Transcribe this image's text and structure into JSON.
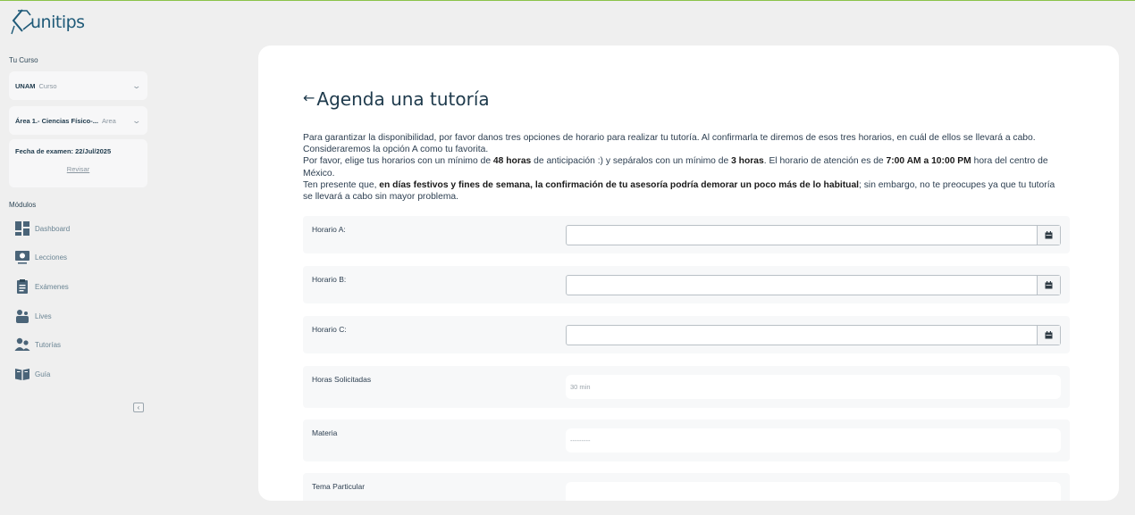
{
  "app": {
    "logo_text": "unitips",
    "logo_icon": "graduation-cap-icon",
    "accent": "#1f5a78",
    "top_border": "#8bc34a"
  },
  "sidebar": {
    "course_label": "Tu Curso",
    "course_select": {
      "strong": "UNAM",
      "muted": "Curso"
    },
    "area_select": {
      "strong": "Área 1.- Ciencias Físico-...",
      "muted": "Area"
    },
    "exam": {
      "text": "Fecha de examen: 22/Jul/2025",
      "link": "Revisar"
    },
    "modules_label": "Módulos",
    "items": [
      {
        "label": "Dashboard",
        "icon": "dashboard-icon"
      },
      {
        "label": "Lecciones",
        "icon": "lessons-icon"
      },
      {
        "label": "Exámenes",
        "icon": "exams-icon"
      },
      {
        "label": "Lives",
        "icon": "lives-icon"
      },
      {
        "label": "Tutorías",
        "icon": "tutoring-icon"
      },
      {
        "label": "Guía",
        "icon": "guide-icon"
      }
    ],
    "collapse_glyph": "‹"
  },
  "main": {
    "back_glyph": "←",
    "title": "Agenda una tutoría",
    "desc": {
      "p1": "Para garantizar la disponibilidad, por favor danos tres opciones de horario para realizar tu tutoría. Al confirmarla te diremos de esos tres horarios, en cuál de ellos se llevará a cabo. Consideraremos la opción A como tu favorita.",
      "p2a": "Por favor, elige tus horarios con un mínimo de ",
      "p2b": "48 horas",
      "p2c": " de anticipación :) y sepáralos con un mínimo de ",
      "p2d": "3 horas",
      "p2e": ". El horario de atención es de ",
      "p2f": "7:00 AM a 10:00 PM",
      "p2g": " hora del centro de México.",
      "p3a": "Ten presente que, ",
      "p3b": "en días festivos y fines de semana, la confirmación de tu asesoría podría demorar un poco más de lo habitual",
      "p3c": "; sin embargo, no te preocupes ya que tu tutoría se llevará a cabo sin mayor problema."
    },
    "fields": {
      "horario_a": {
        "label": "Horario A:",
        "value": ""
      },
      "horario_b": {
        "label": "Horario B:",
        "value": ""
      },
      "horario_c": {
        "label": "Horario C:",
        "value": ""
      },
      "horas": {
        "label": "Horas Solicitadas",
        "value": "30 min"
      },
      "materia": {
        "label": "Materia",
        "value": "---------"
      },
      "tema": {
        "label": "Tema Particular",
        "value": ""
      }
    },
    "calendar_icon": "calendar-icon"
  }
}
